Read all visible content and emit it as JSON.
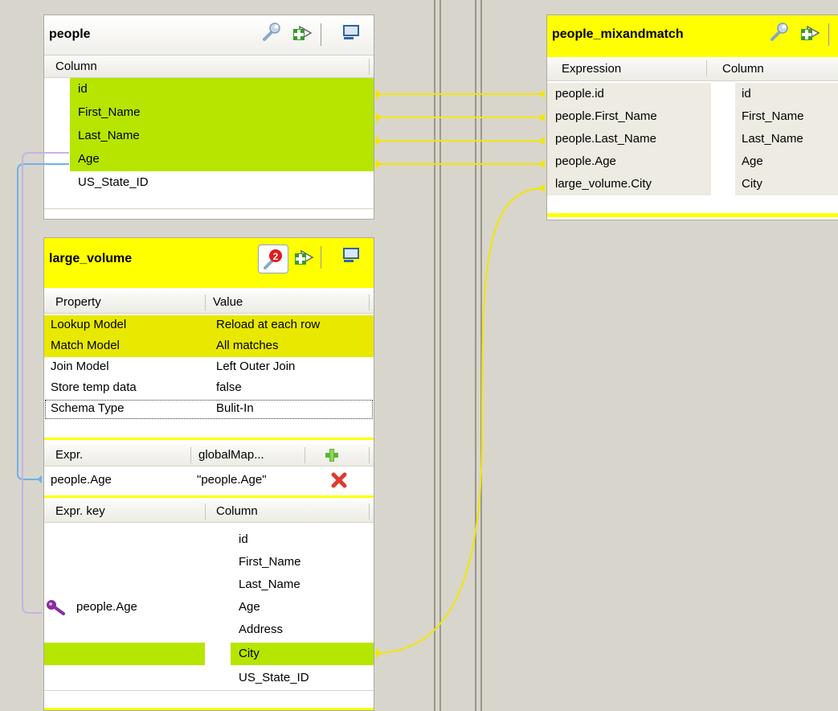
{
  "people": {
    "title": "people",
    "column_header": "Column",
    "rows": [
      "id",
      "First_Name",
      "Last_Name",
      "Age",
      "US_State_ID"
    ]
  },
  "large_volume": {
    "title": "large_volume",
    "badge": "2",
    "props_header": {
      "property": "Property",
      "value": "Value"
    },
    "props": [
      {
        "property": "Lookup Model",
        "value": "Reload at each row"
      },
      {
        "property": "Match Model",
        "value": "All matches"
      },
      {
        "property": "Join Model",
        "value": "Left Outer Join"
      },
      {
        "property": "Store temp data",
        "value": "false"
      },
      {
        "property": "Schema Type",
        "value": "Bulit-In"
      }
    ],
    "expr_header": {
      "expr": "Expr.",
      "global": "globalMap..."
    },
    "expr_row": {
      "expr": "people.Age",
      "global": "\"people.Age\""
    },
    "keys_header": {
      "key": "Expr. key",
      "column": "Column"
    },
    "key_rows": [
      {
        "key": "",
        "column": "id"
      },
      {
        "key": "",
        "column": "First_Name"
      },
      {
        "key": "",
        "column": "Last_Name"
      },
      {
        "key": "people.Age",
        "column": "Age"
      },
      {
        "key": "",
        "column": "Address"
      },
      {
        "key": "",
        "column": "City"
      },
      {
        "key": "",
        "column": "US_State_ID"
      }
    ]
  },
  "output": {
    "title": "people_mixandmatch",
    "header": {
      "expression": "Expression",
      "column": "Column"
    },
    "rows": [
      {
        "expression": "people.id",
        "column": "id"
      },
      {
        "expression": "people.First_Name",
        "column": "First_Name"
      },
      {
        "expression": "people.Last_Name",
        "column": "Last_Name"
      },
      {
        "expression": "people.Age",
        "column": "Age"
      },
      {
        "expression": "large_volume.City",
        "column": "City"
      }
    ]
  },
  "colors": {
    "highlight_green": "#b6e500",
    "lookup_yellow": "#e8e800",
    "title_yellow": "#ffff00",
    "link_yellow": "#f2e600",
    "link_blue": "#6fb2e6",
    "canvas": "#d8d6cc"
  },
  "icons": [
    "wrench-icon",
    "import-arrow-icon",
    "minimize-window-icon",
    "filter-badge-icon",
    "add-icon",
    "delete-icon",
    "key-icon"
  ]
}
